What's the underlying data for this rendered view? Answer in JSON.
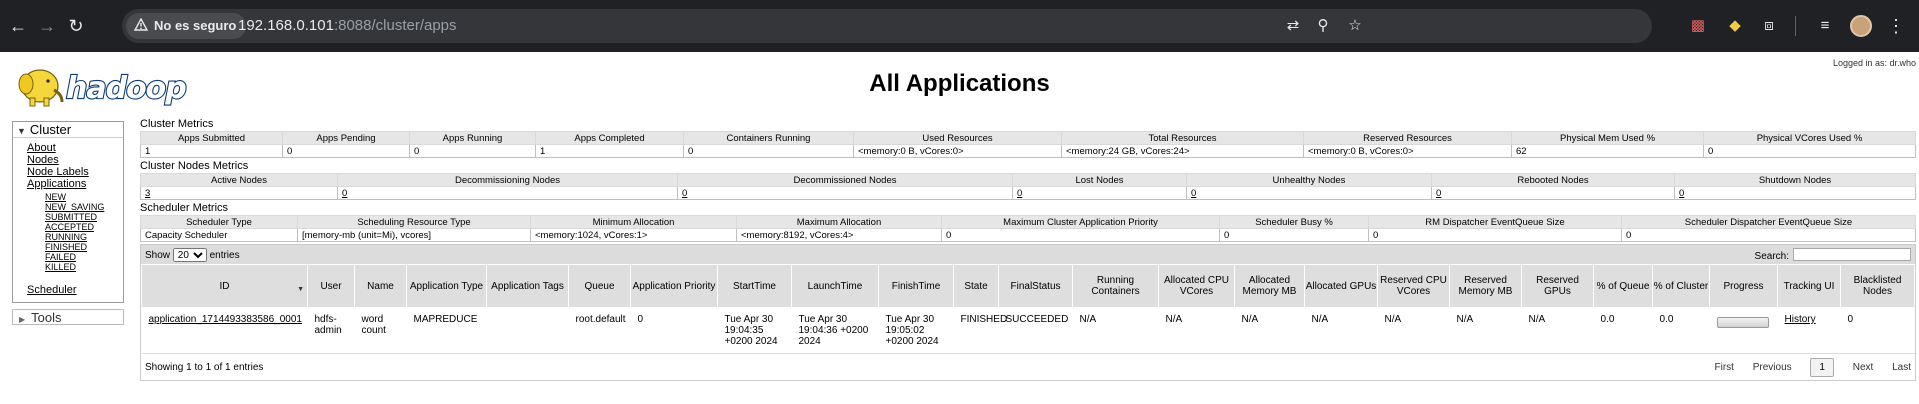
{
  "browser": {
    "security_label": "No es seguro",
    "url_host": "192.168.0.101",
    "url_rest": ":8088/cluster/apps",
    "icons": [
      "back-icon",
      "forward-icon",
      "reload-icon",
      "translate-icon",
      "zoom-icon",
      "star-icon",
      "extension-icon",
      "menu-icon"
    ]
  },
  "header": {
    "logged_in": "Logged in as: dr.who",
    "logo_text": "hadoop",
    "title": "All Applications"
  },
  "sidebar": {
    "cluster_label": "Cluster",
    "links": [
      "About",
      "Nodes",
      "Node Labels",
      "Applications"
    ],
    "app_states": [
      "NEW",
      "NEW_SAVING",
      "SUBMITTED",
      "ACCEPTED",
      "RUNNING",
      "FINISHED",
      "FAILED",
      "KILLED"
    ],
    "scheduler_label": "Scheduler",
    "tools_label": "Tools"
  },
  "cluster_metrics": {
    "title": "Cluster Metrics",
    "headers": [
      "Apps Submitted",
      "Apps Pending",
      "Apps Running",
      "Apps Completed",
      "Containers Running",
      "Used Resources",
      "Total Resources",
      "Reserved Resources",
      "Physical Mem Used %",
      "Physical VCores Used %"
    ],
    "values": [
      "1",
      "0",
      "0",
      "1",
      "0",
      "<memory:0 B, vCores:0>",
      "<memory:24 GB, vCores:24>",
      "<memory:0 B, vCores:0>",
      "62",
      "0"
    ]
  },
  "node_metrics": {
    "title": "Cluster Nodes Metrics",
    "headers": [
      "Active Nodes",
      "Decommissioning Nodes",
      "Decommissioned Nodes",
      "Lost Nodes",
      "Unhealthy Nodes",
      "Rebooted Nodes",
      "Shutdown Nodes"
    ],
    "values": [
      "3",
      "0",
      "0",
      "0",
      "0",
      "0",
      "0"
    ]
  },
  "scheduler_metrics": {
    "title": "Scheduler Metrics",
    "headers": [
      "Scheduler Type",
      "Scheduling Resource Type",
      "Minimum Allocation",
      "Maximum Allocation",
      "Maximum Cluster Application Priority",
      "Scheduler Busy %",
      "RM Dispatcher EventQueue Size",
      "Scheduler Dispatcher EventQueue Size"
    ],
    "values": [
      "Capacity Scheduler",
      "[memory-mb (unit=Mi), vcores]",
      "<memory:1024, vCores:1>",
      "<memory:8192, vCores:4>",
      "0",
      "0",
      "0",
      "0"
    ]
  },
  "apps_table": {
    "show_label": "Show",
    "entries_label": "entries",
    "show_value": "20",
    "search_label": "Search:",
    "headers": [
      "ID",
      "User",
      "Name",
      "Application Type",
      "Application Tags",
      "Queue",
      "Application Priority",
      "StartTime",
      "LaunchTime",
      "FinishTime",
      "State",
      "FinalStatus",
      "Running Containers",
      "Allocated CPU VCores",
      "Allocated Memory MB",
      "Allocated GPUs",
      "Reserved CPU VCores",
      "Reserved Memory MB",
      "Reserved GPUs",
      "% of Queue",
      "% of Cluster",
      "Progress",
      "Tracking UI",
      "Blacklisted Nodes"
    ],
    "row": {
      "id": "application_1714493383586_0001",
      "user": "hdfs-admin",
      "name": "word count",
      "type": "MAPREDUCE",
      "tags": "",
      "queue": "root.default",
      "priority": "0",
      "start": "Tue Apr 30 19:04:35 +0200 2024",
      "launch": "Tue Apr 30 19:04:36 +0200 2024",
      "finish": "Tue Apr 30 19:05:02 +0200 2024",
      "state": "FINISHED",
      "final_status": "SUCCEEDED",
      "running_containers": "N/A",
      "alloc_vcores": "N/A",
      "alloc_mem": "N/A",
      "alloc_gpus": "N/A",
      "res_vcores": "N/A",
      "res_mem": "N/A",
      "res_gpus": "N/A",
      "pct_queue": "0.0",
      "pct_cluster": "0.0",
      "progress": 1.0,
      "tracking": "History",
      "blacklisted": "0"
    },
    "info": "Showing 1 to 1 of 1 entries",
    "pager": {
      "first": "First",
      "previous": "Previous",
      "current": "1",
      "next": "Next",
      "last": "Last"
    }
  }
}
